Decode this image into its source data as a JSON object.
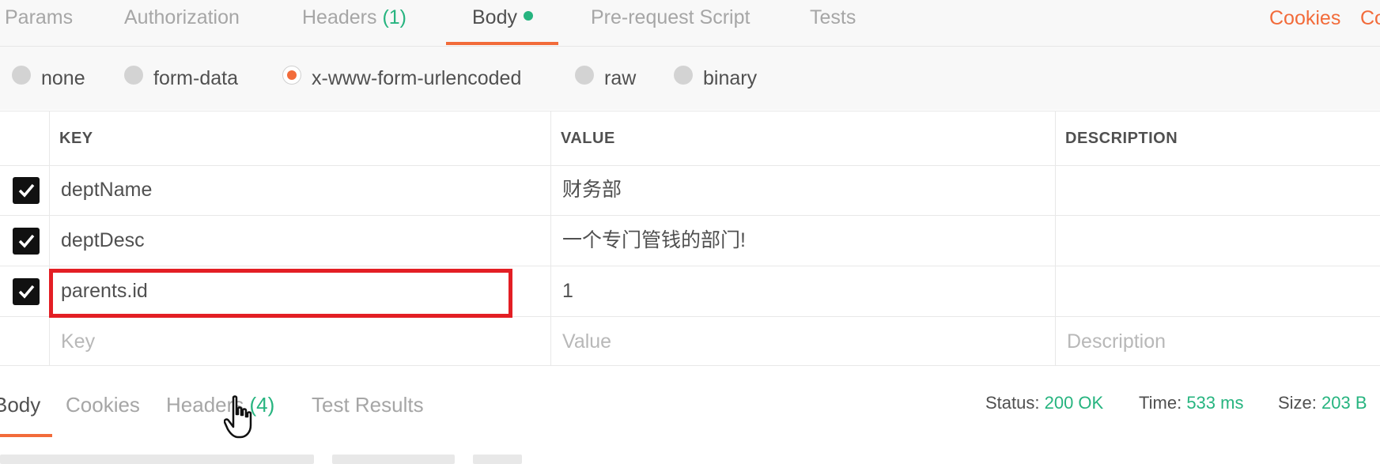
{
  "request_tabs": {
    "params": "Params",
    "authorization": "Authorization",
    "headers": "Headers",
    "headers_count": "(1)",
    "body": "Body",
    "prerequest": "Pre-request Script",
    "tests": "Tests",
    "cookies": "Cookies",
    "code": "Co"
  },
  "body_types": [
    {
      "label": "none",
      "selected": false
    },
    {
      "label": "form-data",
      "selected": false
    },
    {
      "label": "x-www-form-urlencoded",
      "selected": true
    },
    {
      "label": "raw",
      "selected": false
    },
    {
      "label": "binary",
      "selected": false
    }
  ],
  "table": {
    "headers": {
      "key": "KEY",
      "value": "VALUE",
      "description": "DESCRIPTION"
    },
    "rows": [
      {
        "key": "deptName",
        "value": "财务部",
        "description": "",
        "checked": true
      },
      {
        "key": "deptDesc",
        "value": "一个专门管钱的部门!",
        "description": "",
        "checked": true
      },
      {
        "key": "parents.id",
        "value": "1",
        "description": "",
        "checked": true
      }
    ],
    "placeholders": {
      "key": "Key",
      "value": "Value",
      "description": "Description"
    }
  },
  "response_tabs": {
    "body": "Body",
    "cookies": "Cookies",
    "headers": "Headers",
    "headers_count": "(4)",
    "test_results": "Test Results"
  },
  "response_status": {
    "status_label": "Status:",
    "status_value": "200 OK",
    "time_label": "Time:",
    "time_value": "533 ms",
    "size_label": "Size:",
    "size_value": "203 B"
  },
  "colors": {
    "accent": "#f26b3a",
    "success": "#26b47f",
    "highlight": "#e31e24"
  }
}
